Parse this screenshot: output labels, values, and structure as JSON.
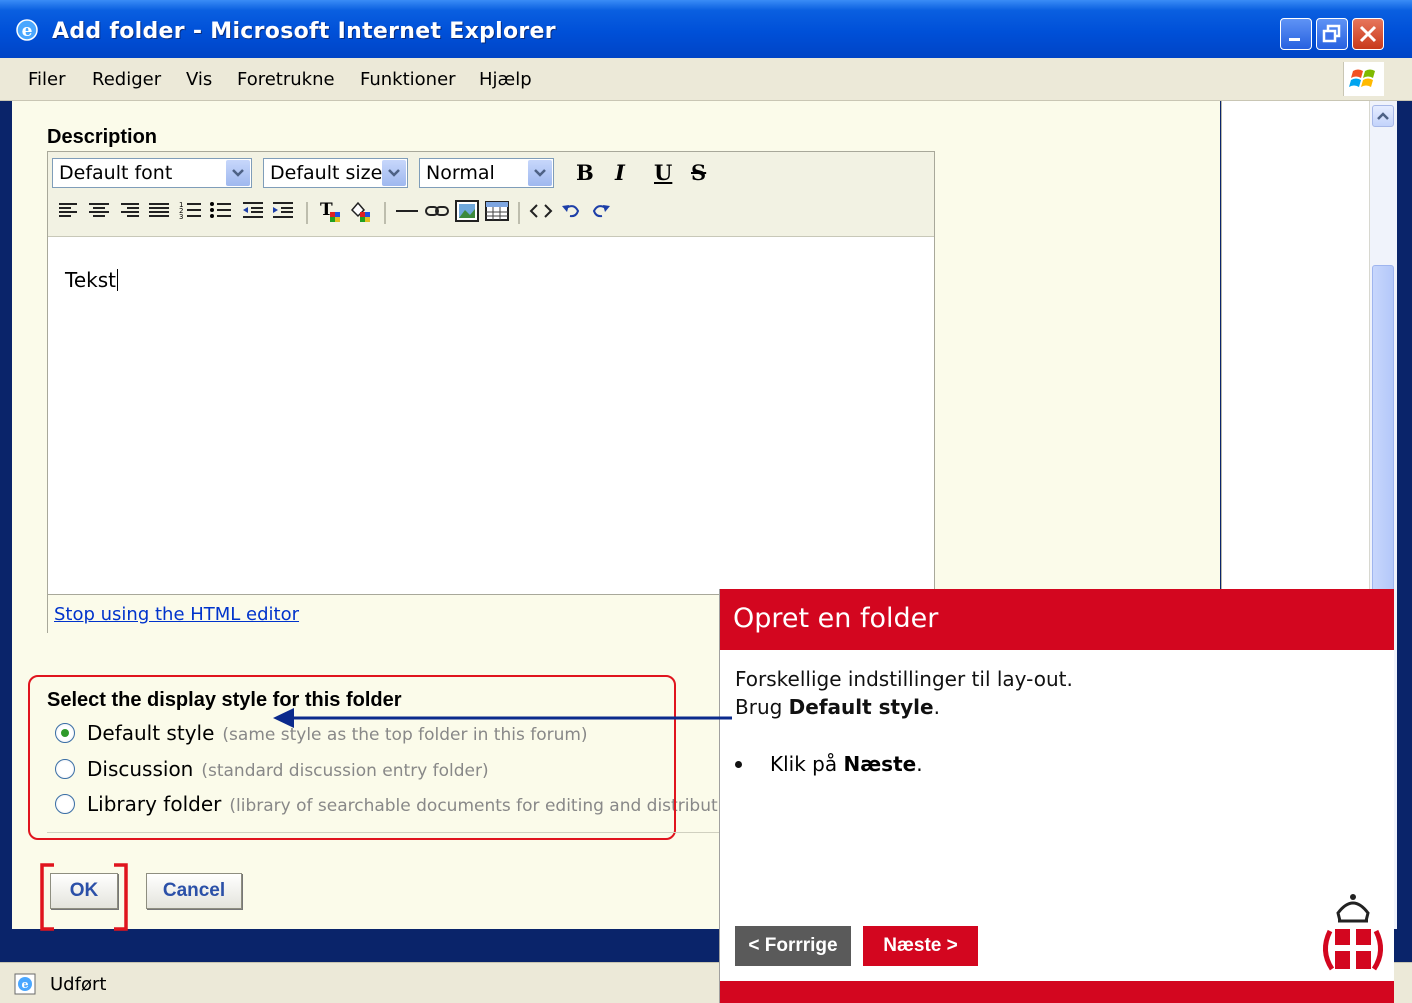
{
  "window": {
    "title": "Add folder - Microsoft Internet Explorer",
    "status_text": "Udført"
  },
  "menu": [
    "Filer",
    "Rediger",
    "Vis",
    "Foretrukne",
    "Funktioner",
    "Hjælp"
  ],
  "editor": {
    "section_title": "Description",
    "font_select": "Default font",
    "size_select": "Default size",
    "format_select": "Normal",
    "bold": "B",
    "italic": "I",
    "underline": "U",
    "strike": "S",
    "content": "Tekst",
    "stop_link": "Stop using the HTML editor"
  },
  "display_style": {
    "title": "Select the display style for this folder",
    "options": [
      {
        "label": "Default style",
        "hint": "(same style as the top folder in this forum)",
        "selected": true
      },
      {
        "label": "Discussion",
        "hint": "(standard discussion entry folder)",
        "selected": false
      },
      {
        "label": "Library folder",
        "hint": "(library of searchable documents for editing and distributio",
        "selected": false
      }
    ]
  },
  "actions": {
    "ok": "OK",
    "cancel": "Cancel"
  },
  "tutorial": {
    "title": "Opret en folder",
    "line1": "Forskellige indstillinger til lay-out.",
    "line2_prefix": "Brug ",
    "line2_bold": "Default style",
    "line2_suffix": ".",
    "bullet_prefix": "Klik på ",
    "bullet_bold": "Næste",
    "bullet_suffix": ".",
    "prev_label": "< Forrrige",
    "next_label": "Næste >"
  },
  "colors": {
    "tutorial_red": "#d3061f",
    "annotation_red": "#e0141e",
    "arrow_blue": "#0b2a8c",
    "titlebar_blue": "#0050d8"
  }
}
